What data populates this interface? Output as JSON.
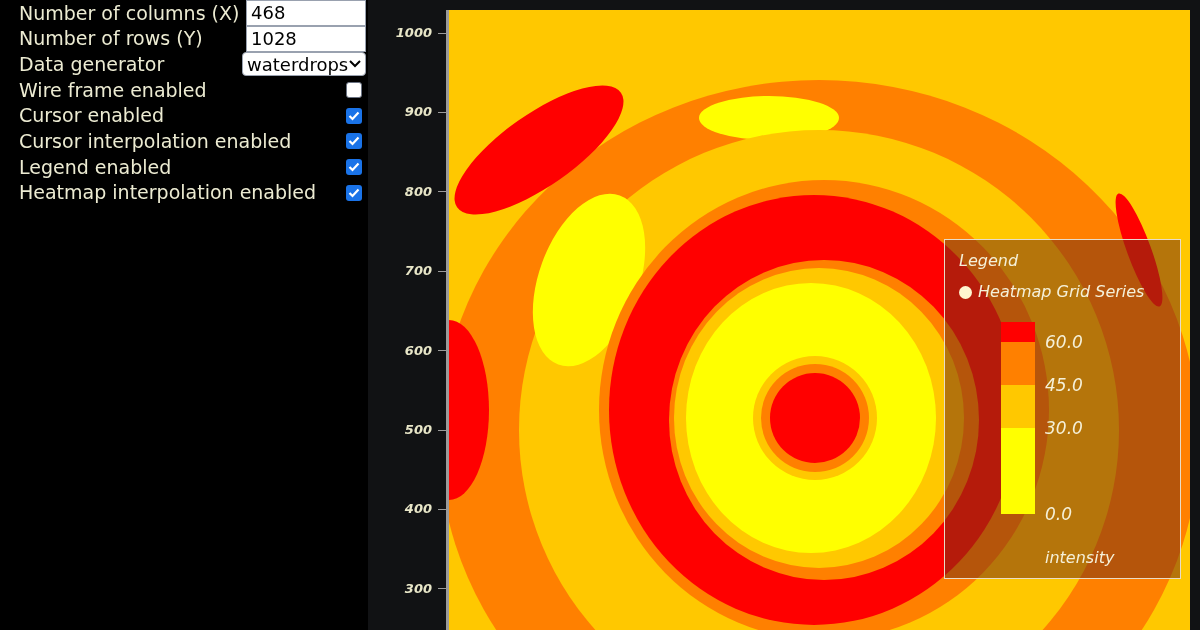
{
  "controls": [
    {
      "kind": "number",
      "label": "Number of columns (X)",
      "value": "468"
    },
    {
      "kind": "number",
      "label": "Number of rows (Y)",
      "value": "1028"
    },
    {
      "kind": "select",
      "label": "Data generator",
      "value": "waterdrops"
    },
    {
      "kind": "checkbox",
      "label": "Wire frame enabled",
      "checked": false
    },
    {
      "kind": "checkbox",
      "label": "Cursor enabled",
      "checked": true
    },
    {
      "kind": "checkbox",
      "label": "Cursor interpolation enabled",
      "checked": true
    },
    {
      "kind": "checkbox",
      "label": "Legend enabled",
      "checked": true
    },
    {
      "kind": "checkbox",
      "label": "Heatmap interpolation enabled",
      "checked": true
    }
  ],
  "chart": {
    "y_ticks": [
      "1000",
      "900",
      "800",
      "700",
      "600",
      "500",
      "400",
      "300"
    ],
    "legend": {
      "title": "Legend",
      "series": "Heatmap Grid Series",
      "bands": [
        {
          "color": "#ff0000"
        },
        {
          "color": "#ff8000",
          "label": "60.0"
        },
        {
          "color": "#ffc800",
          "label": "45.0"
        },
        {
          "color": "#ffff00",
          "label": "30.0"
        }
      ],
      "min_label": "0.0",
      "axis_title": "intensity"
    }
  }
}
